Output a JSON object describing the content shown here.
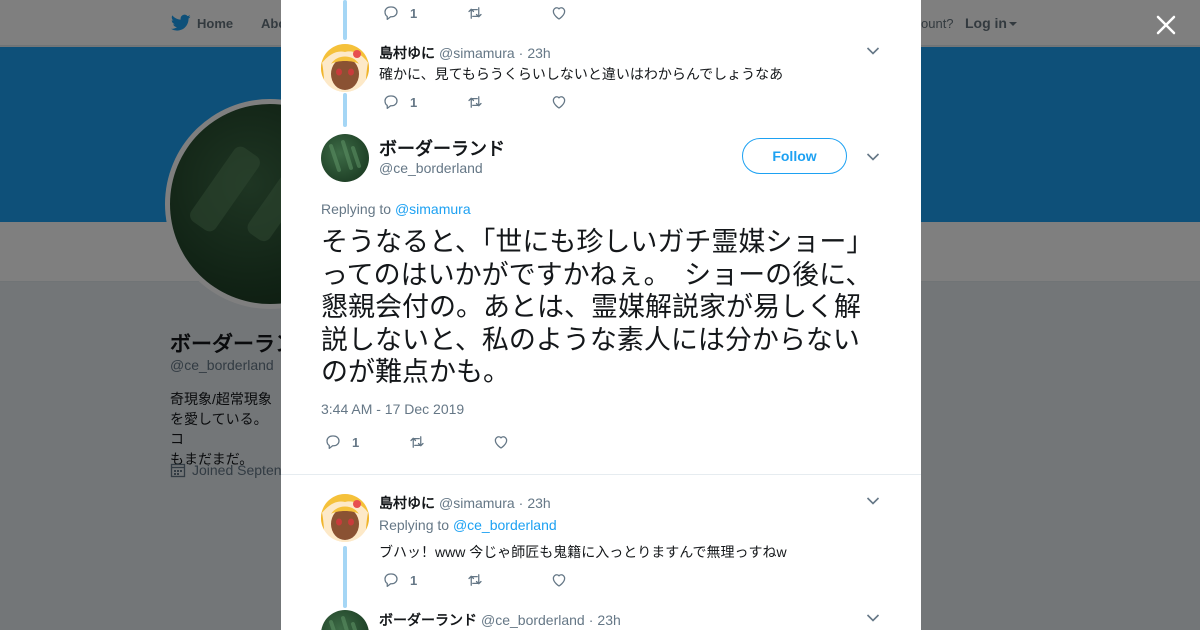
{
  "topbar": {
    "home": "Home",
    "about": "Abo",
    "have_account": "ccount?",
    "login": "Log in"
  },
  "profile": {
    "name": "ボーダーラン",
    "handle": "@ce_borderland",
    "bio_line1": "奇現象/超常現象",
    "bio_line2": "を愛している。 コ",
    "bio_line3": "もまだまだ。",
    "joined": "Joined Septen"
  },
  "colors": {
    "accent": "#1da1f2",
    "thread_line": "#a5d6f5",
    "banner": "#1da1f2"
  },
  "thread": {
    "top_actions": {
      "reply_count": "1"
    },
    "reply1": {
      "name": "島村ゆに",
      "handle": "@simamura",
      "time": "23h",
      "text": "確かに、見てもらうくらいしないと違いはわからんでしょうなあ",
      "reply_count": "1"
    },
    "main": {
      "name": "ボーダーランド",
      "handle": "@ce_borderland",
      "follow_label": "Follow",
      "replying_label": "Replying to",
      "replying_to": "@simamura",
      "text": "そうなると、「世にも珍しいガチ霊媒ショー」ってのはいかがですかねぇ。　ショーの後に、懇親会付の。あとは、霊媒解説家が易しく解説しないと、私のような素人には分からないのが難点かも。",
      "timestamp": "3:44 AM - 17 Dec 2019",
      "reply_count": "1"
    },
    "reply2": {
      "name": "島村ゆに",
      "handle": "@simamura",
      "time": "23h",
      "replying_label": "Replying to",
      "replying_to": "@ce_borderland",
      "text": "ブハッ！www 今じゃ師匠も鬼籍に入っとりますんで無理っすねw",
      "reply_count": "1"
    },
    "reply3": {
      "name": "ボーダーランド",
      "handle": "@ce_borderland",
      "time": "23h"
    }
  },
  "icons": [
    "twitter-bird-icon",
    "close-icon",
    "reply-icon",
    "retweet-icon",
    "like-icon",
    "chevron-down-icon",
    "calendar-icon"
  ]
}
